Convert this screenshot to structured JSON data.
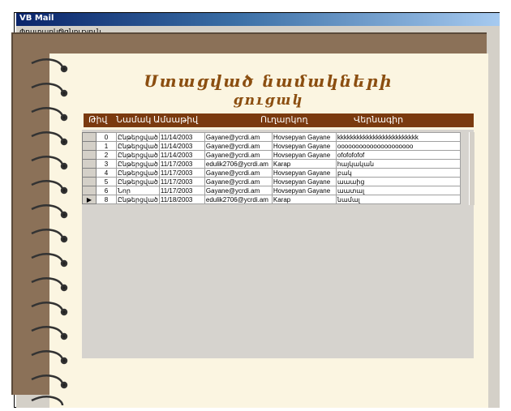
{
  "window": {
    "title": "VB Mail"
  },
  "menu": [
    "Փոստարկղ",
    "Օգնություն"
  ],
  "page": {
    "title_line1": "Ստացված նամակների",
    "title_line2": "ցուցակ"
  },
  "columns": [
    "Թիվ",
    "Նամակ",
    "Ամսաթիվ",
    "Ուղարկող",
    "Վերնագիր"
  ],
  "rows": [
    {
      "num": "0",
      "status": "Ընթերցված",
      "date": "11/14/2003",
      "from": "Gayane@ycrdi.am",
      "to": "Hovsepyan Gayane",
      "subject": "kkkkkkkkkkkkkkkkkkkkkkkkk"
    },
    {
      "num": "1",
      "status": "Ընթերցված",
      "date": "11/14/2003",
      "from": "Gayane@ycrdi.am",
      "to": "Hovsepyan Gayane",
      "subject": "ooooooooooooooooooooo"
    },
    {
      "num": "2",
      "status": "Ընթերցված",
      "date": "11/14/2003",
      "from": "Gayane@ycrdi.am",
      "to": "Hovsepyan Gayane",
      "subject": "ofofofofof"
    },
    {
      "num": "3",
      "status": "Ընթերցված",
      "date": "11/17/2003",
      "from": "edulik2706@ycrdi.am",
      "to": "Karap",
      "subject": "hայկական"
    },
    {
      "num": "4",
      "status": "Ընթերցված",
      "date": "11/17/2003",
      "from": "Gayane@ycrdi.am",
      "to": "Hovsepyan Gayane",
      "subject": "բակ"
    },
    {
      "num": "5",
      "status": "Ընթերցված",
      "date": "11/17/2003",
      "from": "Gayane@ycrdi.am",
      "to": "Hovsepyan Gayane",
      "subject": "աաաից"
    },
    {
      "num": "6",
      "status": "Նոր",
      "date": "11/17/2003",
      "from": "Gayane@ycrdi.am",
      "to": "Hovsepyan Gayane",
      "subject": "աատալ"
    },
    {
      "num": "8",
      "status": "Ընթերցված",
      "date": "11/18/2003",
      "from": "edulik2706@ycrdi.am",
      "to": "Karap",
      "subject": "նամալ"
    }
  ],
  "selected_row_marker": "▶"
}
